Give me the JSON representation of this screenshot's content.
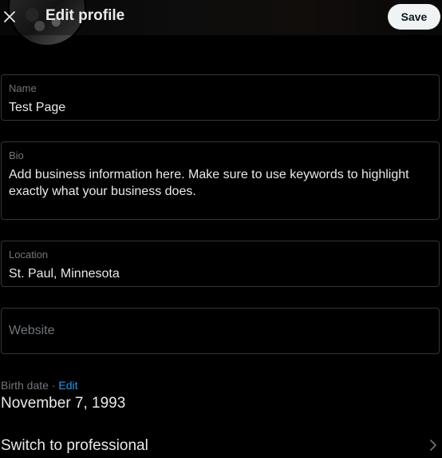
{
  "header": {
    "title": "Edit profile",
    "close_icon": "close-icon",
    "save_label": "Save"
  },
  "fields": {
    "name": {
      "label": "Name",
      "value": "Test Page"
    },
    "bio": {
      "label": "Bio",
      "value": "Add business information here. Make sure to use keywords to highlight exactly what your business does."
    },
    "location": {
      "label": "Location",
      "value": "St. Paul, Minnesota"
    },
    "website": {
      "placeholder": "Website",
      "value": ""
    }
  },
  "birth": {
    "label": "Birth date",
    "separator": " · ",
    "edit_label": "Edit",
    "value": "November 7, 1993"
  },
  "professional": {
    "label": "Switch to professional",
    "icon": "chevron-right-icon"
  },
  "colors": {
    "background": "#000000",
    "text": "#e7e9ea",
    "muted": "#71767b",
    "accent": "#1d9bf0",
    "border": "#333639",
    "save_bg": "#eff3f4"
  }
}
